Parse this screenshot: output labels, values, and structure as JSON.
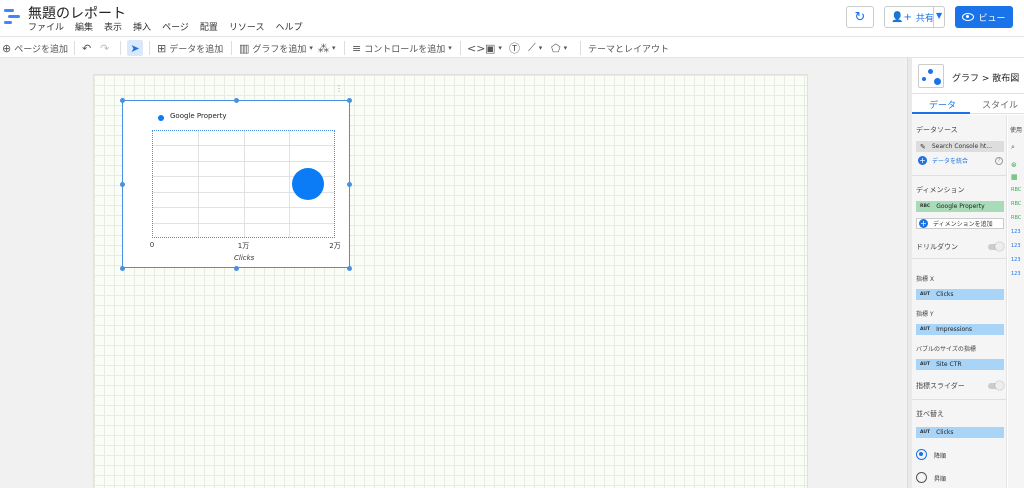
{
  "app": {
    "doc_title": "無題のレポート",
    "menu": [
      "ファイル",
      "編集",
      "表示",
      "挿入",
      "ページ",
      "配置",
      "リソース",
      "ヘルプ"
    ],
    "share_label": "共有",
    "view_label": "ビュー",
    "brand_color": "#4285f4",
    "accent_color": "#1a73e8"
  },
  "toolbar": {
    "add_page": "ページを追加",
    "add_data": "データを追加",
    "add_chart": "グラフを追加",
    "add_control": "コントロールを追加",
    "theme_layout": "テーマとレイアウト"
  },
  "chart_data": {
    "type": "scatter",
    "legend": "Google Property",
    "xlabel": "Clicks",
    "ylabel": "",
    "x_ticks": [
      "0",
      "1万",
      "2万"
    ],
    "xlim": [
      0,
      20000
    ],
    "series": [
      {
        "name": "Google Property",
        "points": [
          {
            "x": 17000,
            "y": 0.5,
            "size": "large"
          }
        ]
      }
    ],
    "bubble_color": "#0b7cf5"
  },
  "panel": {
    "breadcrumb": "グラフ > 散布図",
    "tab_data": "データ",
    "tab_style": "スタイル",
    "datasource_title": "データソース",
    "datasource_value": "Search Console ht...",
    "blend_data": "データを統合",
    "dimension_title": "ディメンション",
    "dimension_value": "Google Property",
    "add_dimension": "ディメンションを追加",
    "drilldown": "ドリルダウン",
    "metric_x_title": "指標 X",
    "metric_x": "Clicks",
    "metric_y_title": "指標 Y",
    "metric_y": "Impressions",
    "bubble_title": "バブルのサイズの指標",
    "bubble_metric": "Site CTR",
    "metric_slider": "指標スライダー",
    "sort_title": "並べ替え",
    "sort_value": "Clicks",
    "sort_asc": "降順",
    "sort_desc": "昇順",
    "available_title": "使用"
  }
}
